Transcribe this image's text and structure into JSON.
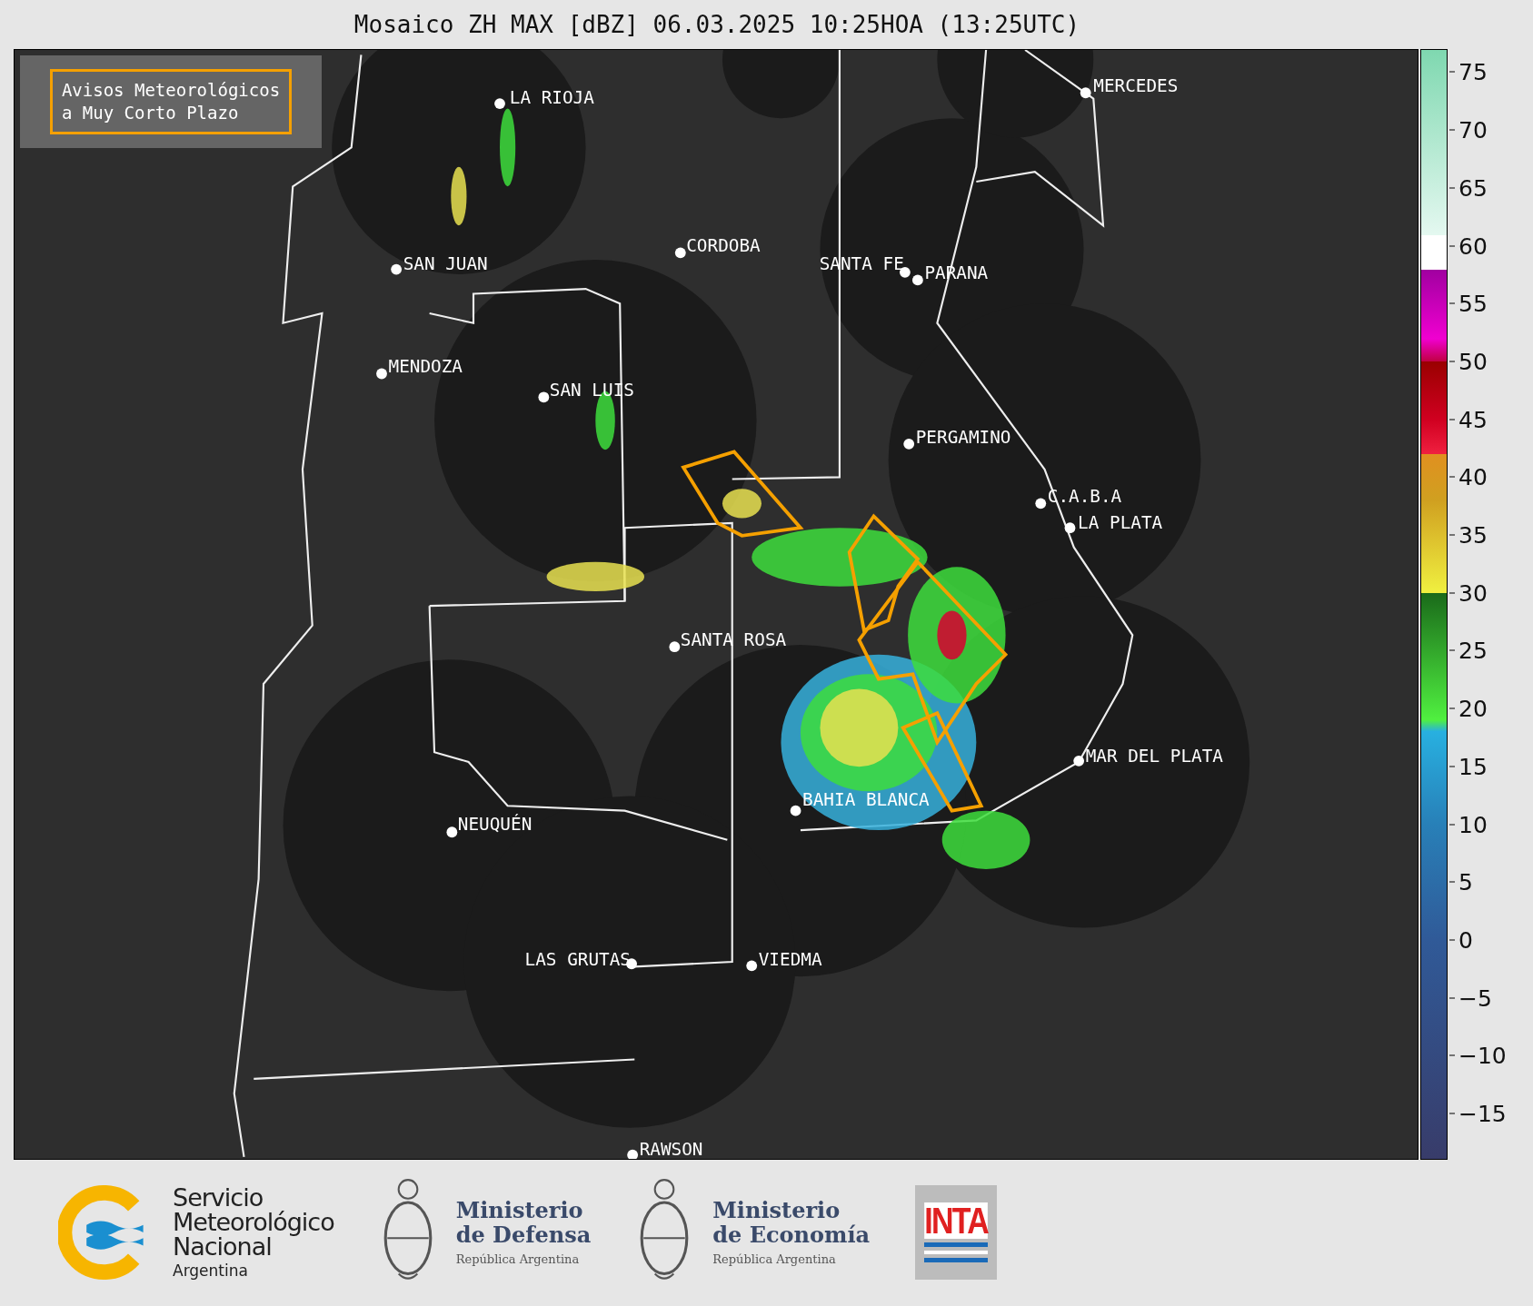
{
  "title": "Mosaico ZH MAX [dBZ] 06.03.2025 10:25HOA (13:25UTC)",
  "map": {
    "legend": {
      "lines": [
        "Avisos Meteorológicos",
        "a Muy Corto Plazo"
      ]
    },
    "cities": [
      {
        "name": "LA RIOJA"
      },
      {
        "name": "SAN JUAN"
      },
      {
        "name": "CORDOBA"
      },
      {
        "name": "SANTA FE"
      },
      {
        "name": "PARANA"
      },
      {
        "name": "MERCEDES"
      },
      {
        "name": "MENDOZA"
      },
      {
        "name": "SAN LUIS"
      },
      {
        "name": "PERGAMINO"
      },
      {
        "name": "C.A.B.A"
      },
      {
        "name": "LA PLATA"
      },
      {
        "name": "SANTA ROSA"
      },
      {
        "name": "MAR DEL PLATA"
      },
      {
        "name": "BAHIA BLANCA"
      },
      {
        "name": "NEUQUÉN"
      },
      {
        "name": "LAS GRUTAS"
      },
      {
        "name": "VIEDMA"
      },
      {
        "name": "RAWSON"
      }
    ]
  },
  "colorbar": {
    "ticks": [
      "75",
      "70",
      "65",
      "60",
      "55",
      "50",
      "45",
      "40",
      "35",
      "30",
      "25",
      "20",
      "15",
      "10",
      "5",
      "0",
      "−5",
      "−10",
      "−15"
    ]
  },
  "footer": {
    "logos": [
      {
        "kind": "smn",
        "lines": [
          "Servicio",
          "Meteorológico",
          "Nacional"
        ],
        "subtitle": "Argentina"
      },
      {
        "kind": "ministry",
        "lines": [
          "Ministerio",
          "de Defensa"
        ],
        "subtitle": "República Argentina"
      },
      {
        "kind": "ministry",
        "lines": [
          "Ministerio",
          "de Economía"
        ],
        "subtitle": "República Argentina"
      },
      {
        "kind": "inta",
        "text": "INTA"
      }
    ]
  }
}
